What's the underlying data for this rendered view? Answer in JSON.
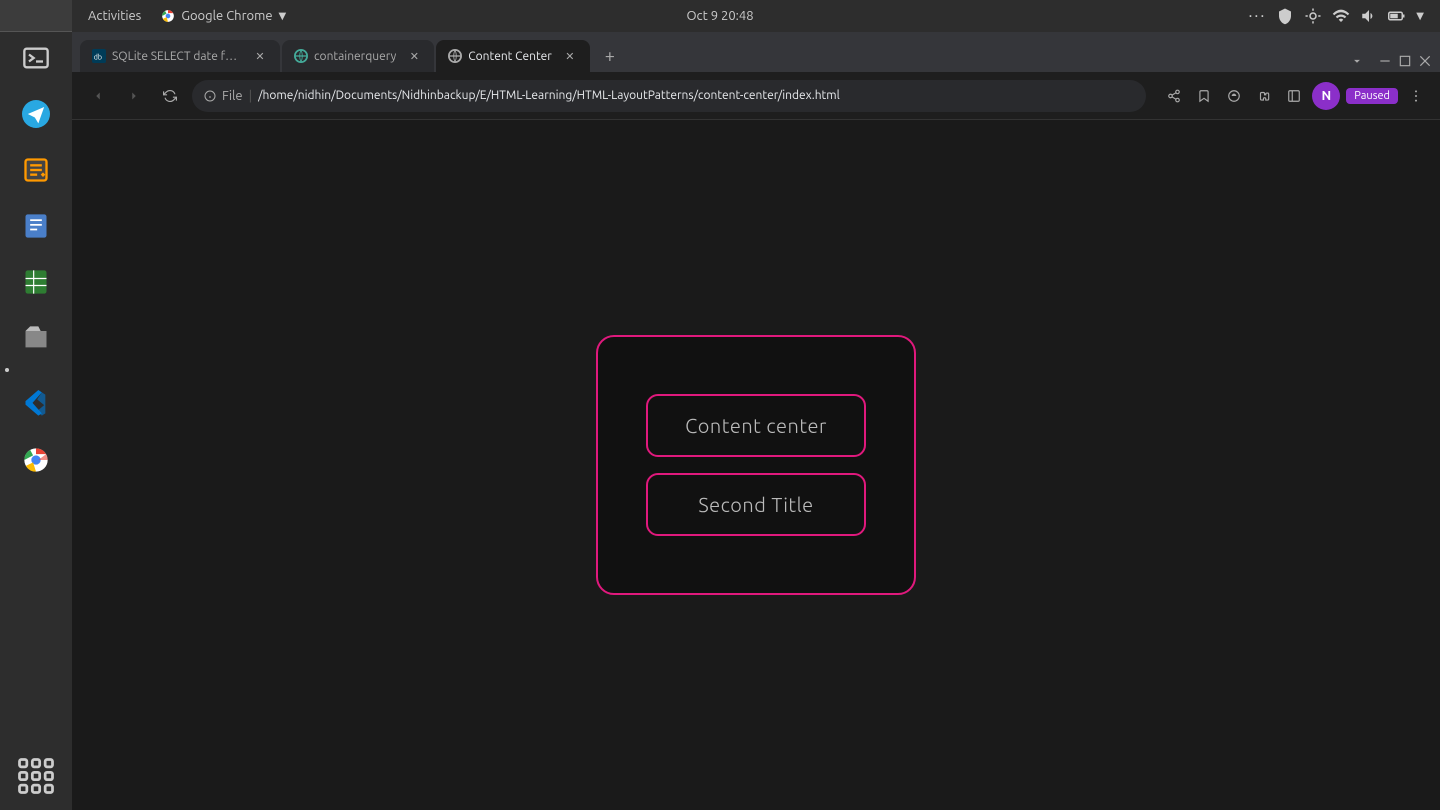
{
  "os": {
    "activities_label": "Activities",
    "app_label": "Google Chrome",
    "datetime": "Oct 9  20:48"
  },
  "taskbar": {
    "icons": [
      {
        "name": "terminal-icon",
        "symbol": "▶",
        "has_dot": false
      },
      {
        "name": "telegram-icon",
        "symbol": "✈",
        "has_dot": false
      },
      {
        "name": "text-editor-icon",
        "symbol": "✏",
        "has_dot": false
      },
      {
        "name": "writer-icon",
        "symbol": "📄",
        "has_dot": false
      },
      {
        "name": "spreadsheet-icon",
        "symbol": "📊",
        "has_dot": false
      },
      {
        "name": "files-icon",
        "symbol": "🗂",
        "has_dot": false
      },
      {
        "name": "vscode-icon",
        "symbol": "◈",
        "has_dot": false
      },
      {
        "name": "chrome-icon",
        "symbol": "⊙",
        "has_dot": false
      }
    ],
    "grid_label": "⠿"
  },
  "browser": {
    "tabs": [
      {
        "id": "tab-sqlite",
        "label": "SQLite SELECT date for a",
        "active": false,
        "favicon": "db"
      },
      {
        "id": "tab-containerquery",
        "label": "containerquery",
        "active": false,
        "favicon": "globe"
      },
      {
        "id": "tab-contentcenter",
        "label": "Content Center",
        "active": true,
        "favicon": "file"
      }
    ],
    "address_bar": {
      "protocol": "File",
      "url": "/home/nidhin/Documents/Nidhinbackup/E/HTML-Learning/HTML-LayoutPatterns/content-center/index.html"
    },
    "profile_initial": "N",
    "paused_label": "Paused"
  },
  "page": {
    "container_box": {
      "first_title": "Content center",
      "second_title": "Second Title"
    }
  }
}
